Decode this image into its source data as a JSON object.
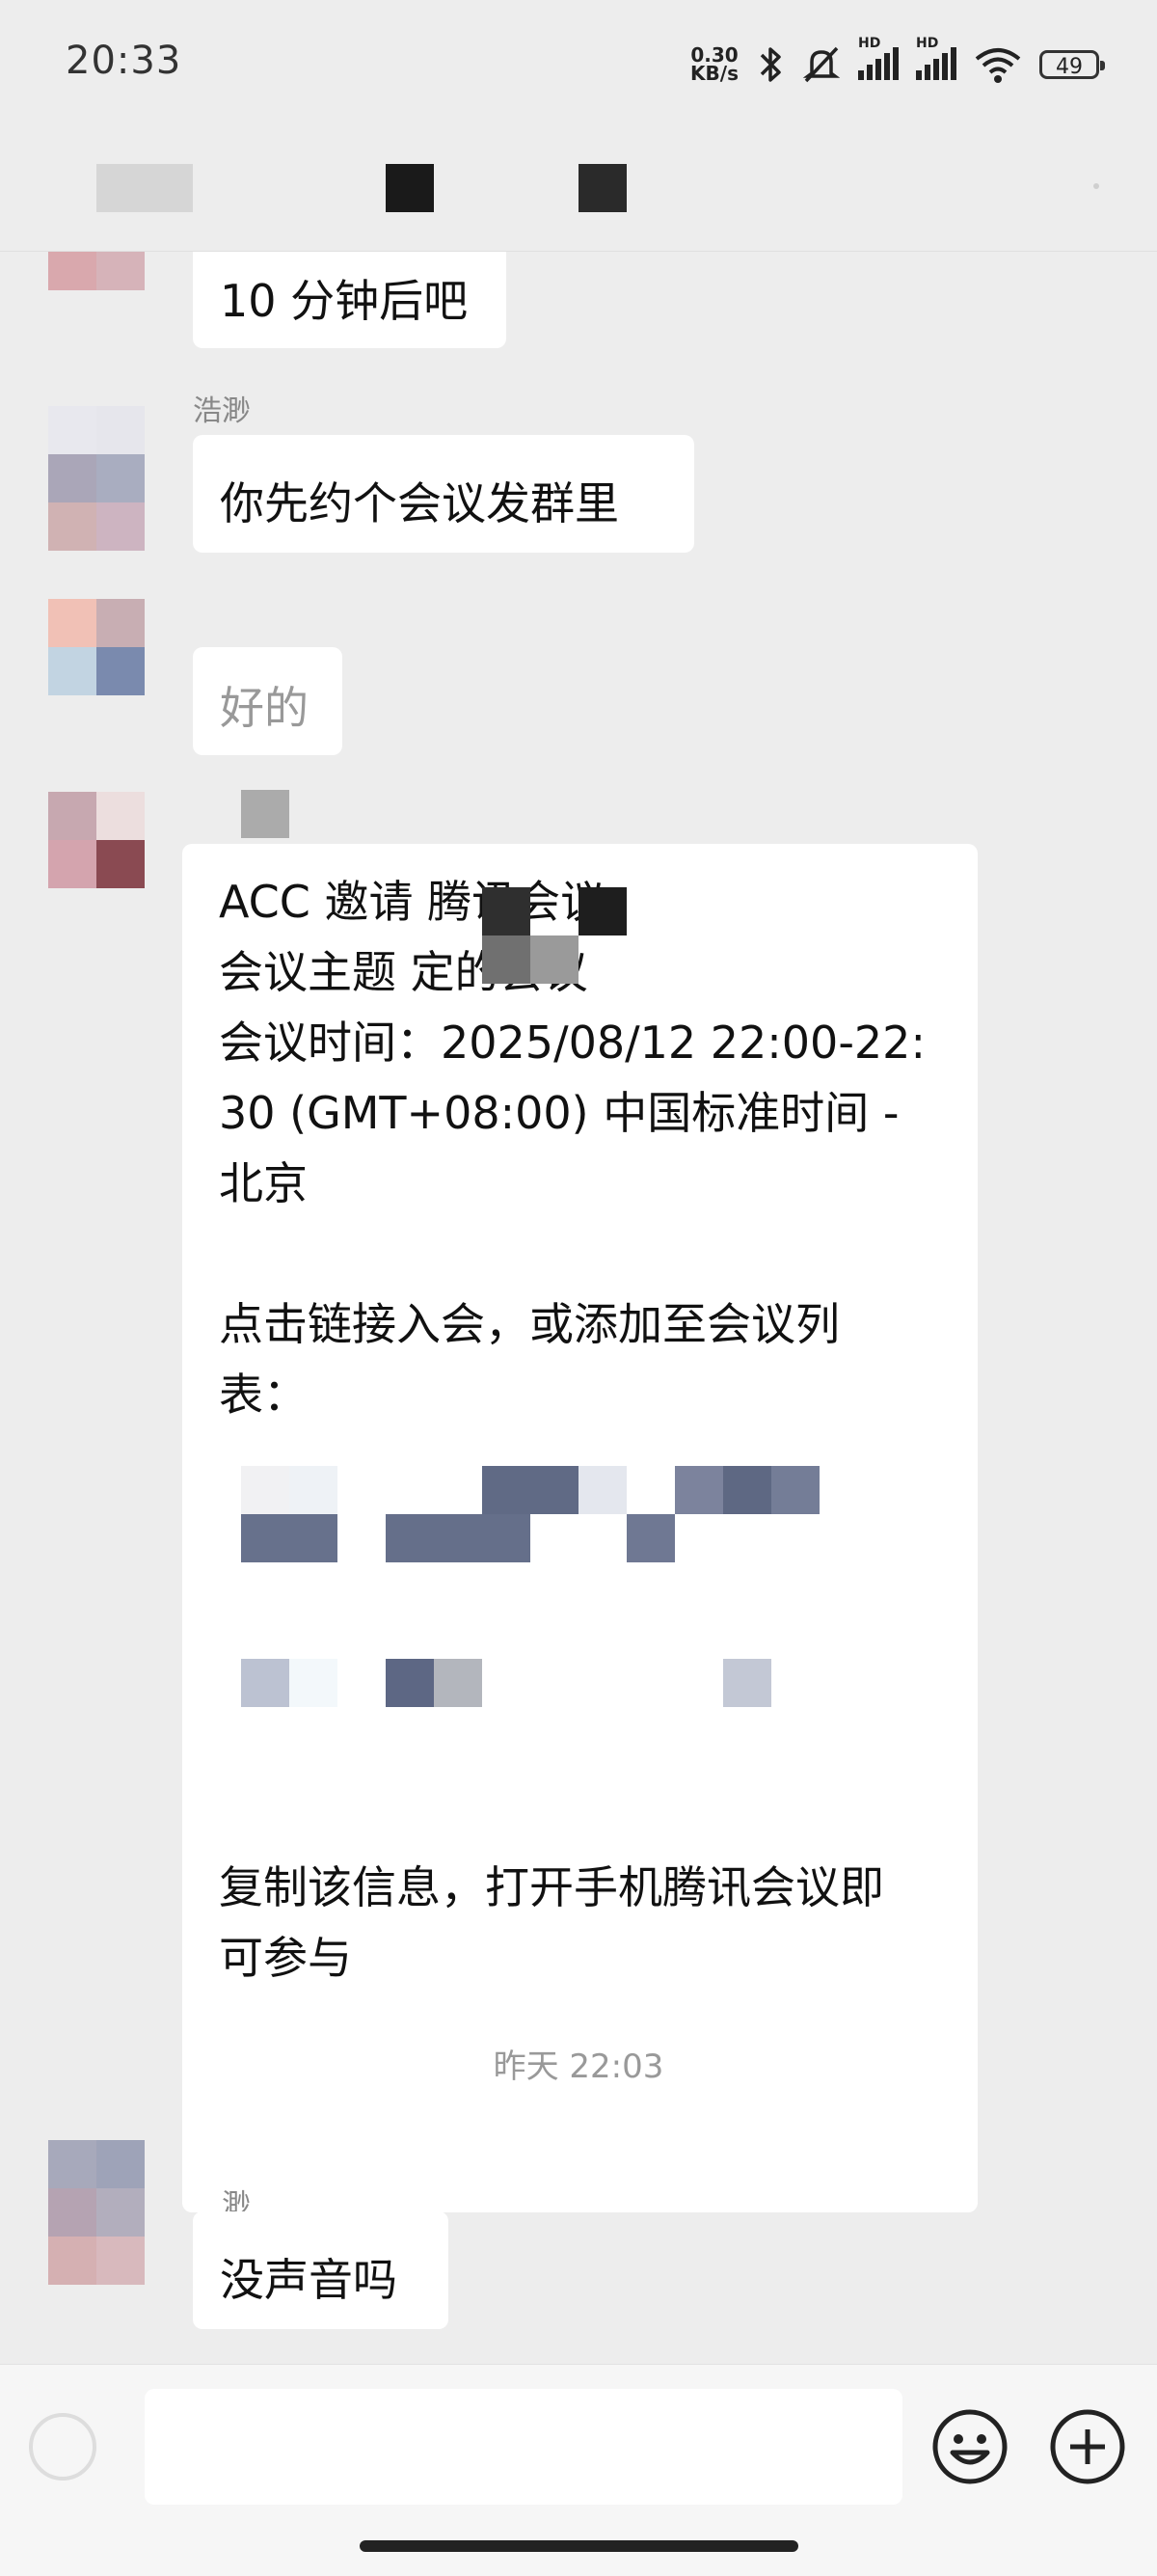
{
  "status": {
    "time": "20:33",
    "net_speed_value": "0.30",
    "net_speed_unit": "KB/s",
    "signal_label_1": "HD",
    "signal_label_2": "HD",
    "battery": "49",
    "icons": [
      "bluetooth-icon",
      "mute-bell-icon",
      "signal-icon",
      "signal-icon",
      "wifi-icon",
      "battery-icon"
    ]
  },
  "messages": [
    {
      "text": "10 分钟后吧"
    },
    {
      "sender": "浩渺",
      "text": "你先约个会议发群里"
    },
    {
      "text": "好的"
    },
    {
      "meeting_lines": [
        "ACC 邀请    腾讯会议",
        "会议主题    定的会议",
        "会议时间：2025/08/12 22:00-22:",
        "30 (GMT+08:00) 中国标准时间 -",
        "北京",
        "",
        "点击链接入会，或添加至会议列",
        "表：",
        "复制该信息，打开手机腾讯会议即",
        "可参与"
      ]
    },
    {
      "sender": "渺",
      "text": "没声音吗"
    }
  ],
  "timestamp": "昨天 22:03",
  "input": {
    "placeholder": ""
  },
  "icons": {
    "emoji": "emoji-icon",
    "add": "add-icon"
  },
  "colors": {
    "background": "#ededed",
    "bubble": "#ffffff",
    "timestamp": "#999999"
  }
}
